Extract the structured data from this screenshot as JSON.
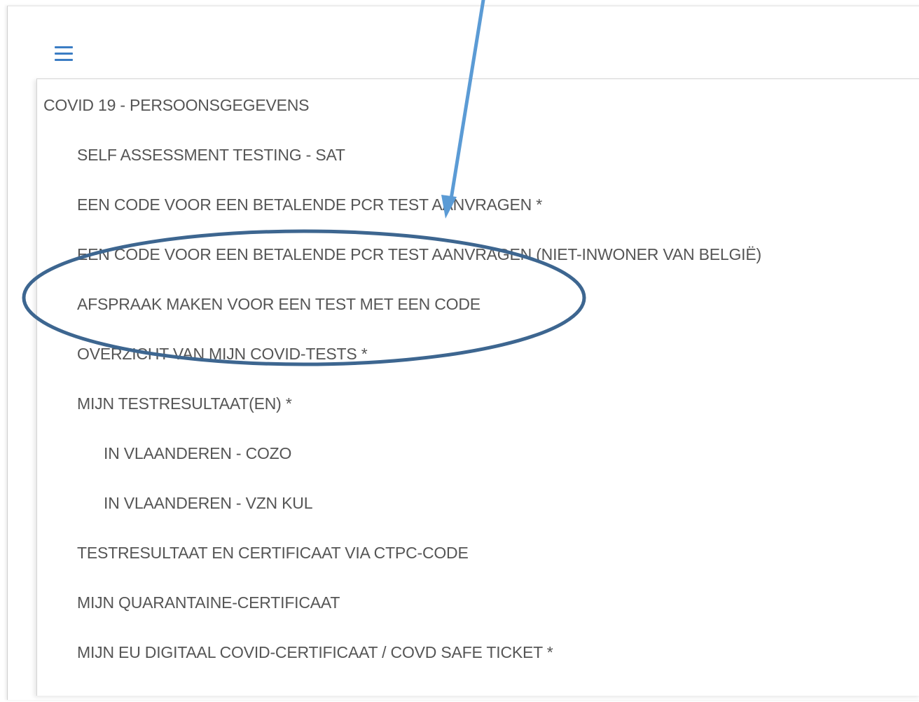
{
  "menu": {
    "heading": "COVID 19 - PERSOONSGEGEVENS",
    "items": [
      {
        "label": "SELF ASSESSMENT TESTING - SAT"
      },
      {
        "label": "EEN CODE VOOR EEN BETALENDE PCR TEST AANVRAGEN *"
      },
      {
        "label": "EEN CODE VOOR EEN BETALENDE PCR TEST AANVRAGEN (NIET-INWONER VAN BELGIË)"
      },
      {
        "label": "AFSPRAAK MAKEN VOOR EEN TEST MET EEN CODE"
      },
      {
        "label": "OVERZICHT VAN MIJN COVID-TESTS *"
      },
      {
        "label": "MIJN TESTRESULTAAT(EN) *"
      },
      {
        "label": "IN VLAANDEREN - COZO"
      },
      {
        "label": "IN VLAANDEREN - VZN KUL"
      },
      {
        "label": "TESTRESULTAAT EN CERTIFICAAT VIA CTPC-CODE"
      },
      {
        "label": "MIJN QUARANTAINE-CERTIFICAAT"
      },
      {
        "label": "MIJN EU DIGITAAL COVID-CERTIFICAAT / COVD SAFE TICKET *"
      }
    ]
  },
  "icons": {
    "menu_toggle": "hamburger-icon"
  },
  "colors": {
    "accent": "#3b7dc4",
    "arrow": "#5b9bd5",
    "ellipse": "#3d6690",
    "text": "#555555"
  }
}
